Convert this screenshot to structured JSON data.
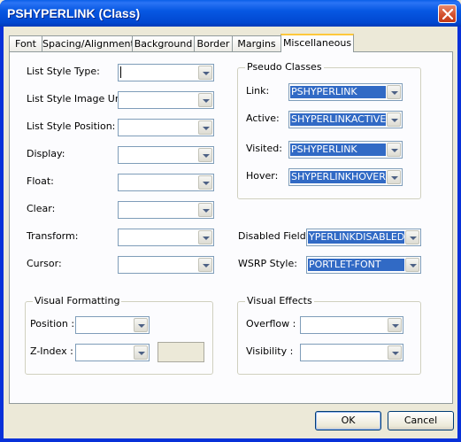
{
  "window": {
    "title": "PSHYPERLINK (Class)"
  },
  "tabs": [
    {
      "label": "Font",
      "active": false
    },
    {
      "label": "Spacing/Alignment",
      "active": false
    },
    {
      "label": "Background",
      "active": false
    },
    {
      "label": "Border",
      "active": false
    },
    {
      "label": "Margins",
      "active": false
    },
    {
      "label": "Miscellaneous",
      "active": true
    }
  ],
  "list_fields": [
    {
      "label": "List Style Type:",
      "value": ""
    },
    {
      "label": "List Style Image Url:",
      "value": ""
    },
    {
      "label": "List Style Position:",
      "value": ""
    },
    {
      "label": "Display:",
      "value": ""
    },
    {
      "label": "Float:",
      "value": ""
    },
    {
      "label": "Clear:",
      "value": ""
    },
    {
      "label": "Transform:",
      "value": ""
    },
    {
      "label": "Cursor:",
      "value": ""
    }
  ],
  "pseudo_classes": {
    "title": "Pseudo Classes",
    "link": {
      "label": "Link:",
      "value": "PSHYPERLINK"
    },
    "active": {
      "label": "Active:",
      "value": "SHYPERLINKACTIVE"
    },
    "visited": {
      "label": "Visited:",
      "value": "PSHYPERLINK"
    },
    "hover": {
      "label": "Hover:",
      "value": "SHYPERLINKHOVER"
    }
  },
  "disabled_field": {
    "label": "Disabled Field:",
    "value": "YPERLINKDISABLED"
  },
  "wsrp_style": {
    "label": "WSRP Style:",
    "value": "PORTLET-FONT"
  },
  "visual_formatting": {
    "title": "Visual Formatting",
    "position": {
      "label": "Position :",
      "value": ""
    },
    "zindex": {
      "label": "Z-Index :",
      "value": ""
    }
  },
  "visual_effects": {
    "title": "Visual Effects",
    "overflow": {
      "label": "Overflow :",
      "value": ""
    },
    "visibility": {
      "label": "Visibility :",
      "value": ""
    }
  },
  "buttons": {
    "ok": "OK",
    "cancel": "Cancel"
  },
  "colors": {
    "selection": "#316ac5",
    "title_bar": "#0054e3",
    "dialog_bg": "#ece9d8"
  }
}
